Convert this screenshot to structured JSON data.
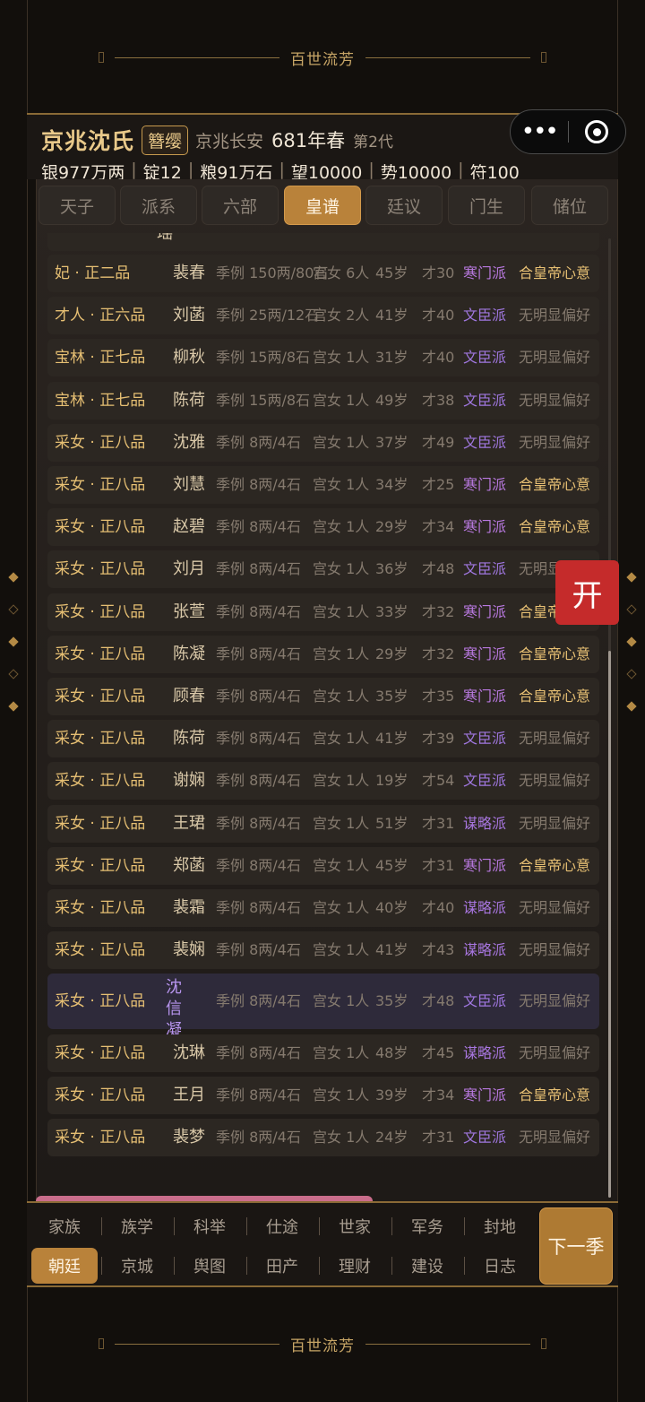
{
  "banner": {
    "title": "百世流芳"
  },
  "header": {
    "clan": "京兆沈氏",
    "rank": "簪缨",
    "place": "京兆长安",
    "year": "681年春",
    "generation": "第2代",
    "stats": [
      "银977万两",
      "锭12",
      "粮91万石",
      "望10000",
      "势10000",
      "符100"
    ]
  },
  "tabs": [
    "天子",
    "派系",
    "六部",
    "皇谱",
    "廷议",
    "门生",
    "储位"
  ],
  "active_tab": "皇谱",
  "list": {
    "partial_name": "瑶",
    "rows": [
      {
        "rank": "妃 · 正二品",
        "name": "裴春",
        "fee": "季例 150两/80石",
        "maids": "宫女 6人",
        "age": "45岁",
        "talent": "才30",
        "faction": "寒门派",
        "attitude": "合皇帝心意"
      },
      {
        "rank": "才人 · 正六品",
        "name": "刘菡",
        "fee": "季例 25两/12石",
        "maids": "宫女 2人",
        "age": "41岁",
        "talent": "才40",
        "faction": "文臣派",
        "attitude": "无明显偏好"
      },
      {
        "rank": "宝林 · 正七品",
        "name": "柳秋",
        "fee": "季例 15两/8石",
        "maids": "宫女 1人",
        "age": "31岁",
        "talent": "才40",
        "faction": "文臣派",
        "attitude": "无明显偏好"
      },
      {
        "rank": "宝林 · 正七品",
        "name": "陈荷",
        "fee": "季例 15两/8石",
        "maids": "宫女 1人",
        "age": "49岁",
        "talent": "才38",
        "faction": "文臣派",
        "attitude": "无明显偏好"
      },
      {
        "rank": "采女 · 正八品",
        "name": "沈雅",
        "fee": "季例 8两/4石",
        "maids": "宫女 1人",
        "age": "37岁",
        "talent": "才49",
        "faction": "文臣派",
        "attitude": "无明显偏好"
      },
      {
        "rank": "采女 · 正八品",
        "name": "刘慧",
        "fee": "季例 8两/4石",
        "maids": "宫女 1人",
        "age": "34岁",
        "talent": "才25",
        "faction": "寒门派",
        "attitude": "合皇帝心意"
      },
      {
        "rank": "采女 · 正八品",
        "name": "赵碧",
        "fee": "季例 8两/4石",
        "maids": "宫女 1人",
        "age": "29岁",
        "talent": "才34",
        "faction": "寒门派",
        "attitude": "合皇帝心意"
      },
      {
        "rank": "采女 · 正八品",
        "name": "刘月",
        "fee": "季例 8两/4石",
        "maids": "宫女 1人",
        "age": "36岁",
        "talent": "才48",
        "faction": "文臣派",
        "attitude": "无明显偏好"
      },
      {
        "rank": "采女 · 正八品",
        "name": "张萱",
        "fee": "季例 8两/4石",
        "maids": "宫女 1人",
        "age": "33岁",
        "talent": "才32",
        "faction": "寒门派",
        "attitude": "合皇帝心意"
      },
      {
        "rank": "采女 · 正八品",
        "name": "陈凝",
        "fee": "季例 8两/4石",
        "maids": "宫女 1人",
        "age": "29岁",
        "talent": "才32",
        "faction": "寒门派",
        "attitude": "合皇帝心意"
      },
      {
        "rank": "采女 · 正八品",
        "name": "顾春",
        "fee": "季例 8两/4石",
        "maids": "宫女 1人",
        "age": "35岁",
        "talent": "才35",
        "faction": "寒门派",
        "attitude": "合皇帝心意"
      },
      {
        "rank": "采女 · 正八品",
        "name": "陈荷",
        "fee": "季例 8两/4石",
        "maids": "宫女 1人",
        "age": "41岁",
        "talent": "才39",
        "faction": "文臣派",
        "attitude": "无明显偏好"
      },
      {
        "rank": "采女 · 正八品",
        "name": "谢娴",
        "fee": "季例 8两/4石",
        "maids": "宫女 1人",
        "age": "19岁",
        "talent": "才54",
        "faction": "文臣派",
        "attitude": "无明显偏好"
      },
      {
        "rank": "采女 · 正八品",
        "name": "王珺",
        "fee": "季例 8两/4石",
        "maids": "宫女 1人",
        "age": "51岁",
        "talent": "才31",
        "faction": "谋略派",
        "attitude": "无明显偏好"
      },
      {
        "rank": "采女 · 正八品",
        "name": "郑菡",
        "fee": "季例 8两/4石",
        "maids": "宫女 1人",
        "age": "45岁",
        "talent": "才31",
        "faction": "寒门派",
        "attitude": "合皇帝心意"
      },
      {
        "rank": "采女 · 正八品",
        "name": "裴霜",
        "fee": "季例 8两/4石",
        "maids": "宫女 1人",
        "age": "40岁",
        "talent": "才40",
        "faction": "谋略派",
        "attitude": "无明显偏好"
      },
      {
        "rank": "采女 · 正八品",
        "name": "裴娴",
        "fee": "季例 8两/4石",
        "maids": "宫女 1人",
        "age": "41岁",
        "talent": "才43",
        "faction": "谋略派",
        "attitude": "无明显偏好"
      },
      {
        "rank": "采女 · 正八品",
        "name": "沈信凝",
        "fee": "季例 8两/4石",
        "maids": "宫女 1人",
        "age": "35岁",
        "talent": "才48",
        "faction": "文臣派",
        "attitude": "无明显偏好"
      },
      {
        "rank": "采女 · 正八品",
        "name": "沈琳",
        "fee": "季例 8两/4石",
        "maids": "宫女 1人",
        "age": "48岁",
        "talent": "才45",
        "faction": "谋略派",
        "attitude": "无明显偏好"
      },
      {
        "rank": "采女 · 正八品",
        "name": "王月",
        "fee": "季例 8两/4石",
        "maids": "宫女 1人",
        "age": "39岁",
        "talent": "才34",
        "faction": "寒门派",
        "attitude": "合皇帝心意"
      },
      {
        "rank": "采女 · 正八品",
        "name": "裴梦",
        "fee": "季例 8两/4石",
        "maids": "宫女 1人",
        "age": "24岁",
        "talent": "才31",
        "faction": "文臣派",
        "attitude": "无明显偏好"
      }
    ]
  },
  "open_button": "开",
  "bottom_nav": {
    "row1": [
      "家族",
      "族学",
      "科举",
      "仕途",
      "世家",
      "军务",
      "封地"
    ],
    "row2": [
      "朝廷",
      "京城",
      "舆图",
      "田产",
      "理财",
      "建设",
      "日志"
    ],
    "active": "朝廷",
    "next_label": "下一季"
  },
  "capsule": {
    "more_label": "•••"
  },
  "colors": {
    "gold": "#e6bf73",
    "accent": "#b9823a",
    "purple": "#a077e0",
    "red": "#c52b2b"
  }
}
